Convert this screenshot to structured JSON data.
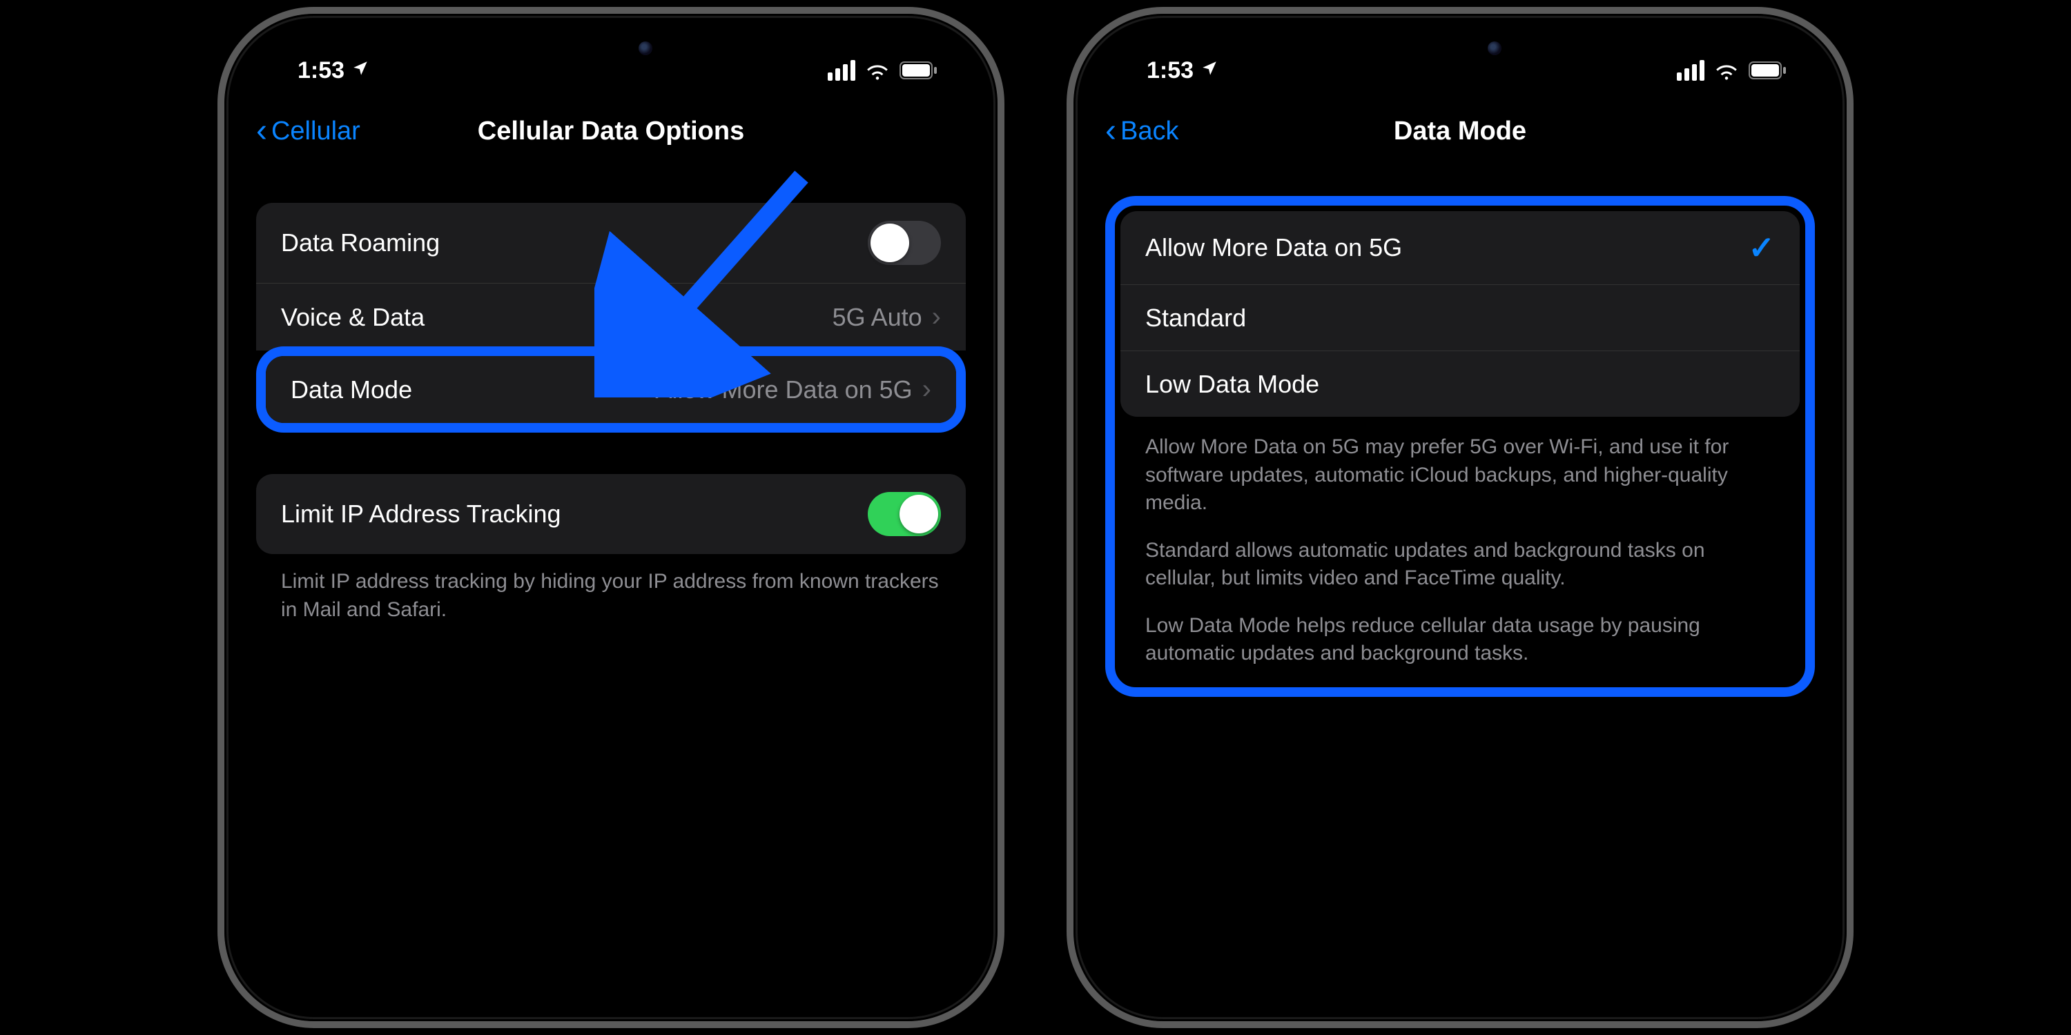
{
  "status": {
    "time": "1:53"
  },
  "phone1": {
    "back_label": "Cellular",
    "title": "Cellular Data Options",
    "rows": {
      "roaming_label": "Data Roaming",
      "voice_label": "Voice & Data",
      "voice_value": "5G Auto",
      "mode_label": "Data Mode",
      "mode_value": "Allow More Data on 5G",
      "limit_label": "Limit IP Address Tracking"
    },
    "limit_footer": "Limit IP address tracking by hiding your IP address from known trackers in Mail and Safari."
  },
  "phone2": {
    "back_label": "Back",
    "title": "Data Mode",
    "options": {
      "opt1": "Allow More Data on 5G",
      "opt2": "Standard",
      "opt3": "Low Data Mode"
    },
    "desc1": "Allow More Data on 5G may prefer 5G over Wi-Fi, and use it for software updates, automatic iCloud backups, and higher-quality media.",
    "desc2": "Standard allows automatic updates and background tasks on cellular, but limits video and FaceTime quality.",
    "desc3": "Low Data Mode helps reduce cellular data usage by pausing automatic updates and background tasks."
  }
}
